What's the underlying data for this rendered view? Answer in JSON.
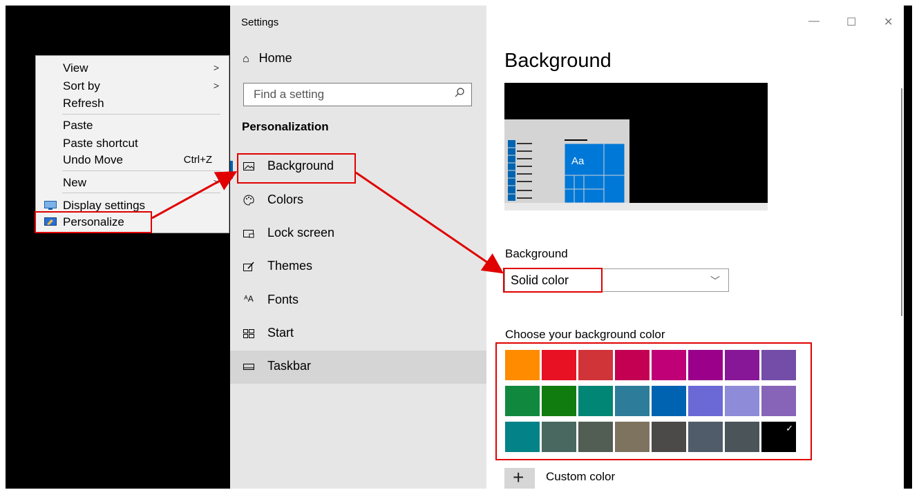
{
  "context_menu": {
    "items": [
      {
        "label": "View",
        "submenu": true
      },
      {
        "label": "Sort by",
        "submenu": true
      },
      {
        "label": "Refresh"
      },
      {
        "label": "Paste",
        "disabled": true
      },
      {
        "label": "Paste shortcut",
        "disabled": true
      },
      {
        "label": "Undo Move",
        "shortcut": "Ctrl+Z"
      },
      {
        "label": "New",
        "submenu": true
      },
      {
        "label": "Display settings",
        "icon": "display-icon"
      },
      {
        "label": "Personalize",
        "icon": "personalize-icon"
      }
    ]
  },
  "window": {
    "title": "Settings",
    "controls": {
      "minimize": "—",
      "maximize": "☐",
      "close": "✕"
    }
  },
  "nav": {
    "home": "Home",
    "search_placeholder": "Find a setting",
    "section": "Personalization",
    "items": [
      {
        "label": "Background",
        "icon": "picture-icon",
        "selected": true
      },
      {
        "label": "Colors",
        "icon": "palette-icon"
      },
      {
        "label": "Lock screen",
        "icon": "lock-screen-icon"
      },
      {
        "label": "Themes",
        "icon": "themes-icon"
      },
      {
        "label": "Fonts",
        "icon": "fonts-icon"
      },
      {
        "label": "Start",
        "icon": "start-icon"
      },
      {
        "label": "Taskbar",
        "icon": "taskbar-icon",
        "hovered": true
      }
    ]
  },
  "main": {
    "title": "Background",
    "preview_tile_text": "Aa",
    "background_label": "Background",
    "background_value": "Solid color",
    "color_label": "Choose your background color",
    "custom_color": "Custom color",
    "colors": [
      [
        "#ff8c00",
        "#e81123",
        "#d13438",
        "#c30052",
        "#bf0077",
        "#9a0089",
        "#881798",
        "#744da9"
      ],
      [
        "#10893e",
        "#107c10",
        "#018574",
        "#2d7d9a",
        "#0063b1",
        "#6b69d6",
        "#8e8cd8",
        "#8764b8"
      ],
      [
        "#038387",
        "#486860",
        "#525e54",
        "#7e735f",
        "#4c4a48",
        "#515c6b",
        "#4a5459",
        "#000000"
      ]
    ],
    "selected_color": "#000000"
  },
  "accent_color": "#0063b1",
  "annotation_color": "#e00000"
}
